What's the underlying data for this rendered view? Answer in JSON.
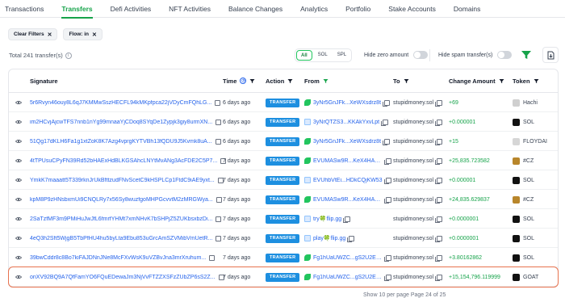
{
  "tabs": [
    "Transactions",
    "Transfers",
    "Defi Activities",
    "NFT Activities",
    "Balance Changes",
    "Analytics",
    "Portfolio",
    "Stake Accounts",
    "Domains"
  ],
  "active_tab": "Transfers",
  "chips": [
    {
      "label": "Clear Filters"
    },
    {
      "label": "Flow: in"
    }
  ],
  "total_text": "Total 241 transfer(s)",
  "segments": [
    "All",
    "SOL",
    "SPL"
  ],
  "active_segment": "All",
  "hide_zero_label": "Hide zero amount",
  "hide_spam_label": "Hide spam transfer(s)",
  "columns": {
    "signature": "Signature",
    "time": "Time",
    "action": "Action",
    "from": "From",
    "to": "To",
    "amount": "Change Amount",
    "token": "Token"
  },
  "colors": {
    "accent": "#16a34a",
    "badge": "#1d8fe0",
    "link": "#2563eb",
    "highlight": "#e8734f"
  },
  "rows": [
    {
      "signature": "5r6Rvyn46ouy8L6qJ7KMMwSszHECFL94kMKpfpca22jVDyCmFQhLG...",
      "time": "6 days ago",
      "action": "TRANSFER",
      "from": "3yNr5GnJFk...XeWXsdrz8t",
      "from_icon": "green-leaf-icon",
      "to": "stupidmoney.sol",
      "amount": "+69",
      "token": "Hachi",
      "token_color": "#cfcfcf"
    },
    {
      "signature": "im2HCvjAjcwTFS7nnb1nYg99mnaaYjCDoq8SYqDe1Zypjk3giy8urmXN...",
      "time": "6 days ago",
      "action": "TRANSFER",
      "from": "3yNrQTZS3...KKAkYxvLpt",
      "from_icon": "document-icon",
      "to": "stupidmoney.sol",
      "amount": "+0.000001",
      "token": "SOL",
      "token_color": "#111111"
    },
    {
      "signature": "51Qg17dKLH6Fa1g1xtZoK8K7Azg4vprgKYTVBh13fQDU9J5Kvmk8uA...",
      "time": "6 days ago",
      "action": "TRANSFER",
      "from": "3yNr5GnJFk...XeWXsdrz8t",
      "from_icon": "green-leaf-icon",
      "to": "stupidmoney.sol",
      "amount": "+15",
      "token": "FLOYDAI",
      "token_color": "#d6d6d6"
    },
    {
      "signature": "4tTPUsuCPyFN39Rd52bHAExHdBLKGSAhcLNYtMvANg3AcFDE2C5P7...",
      "time": "7 days ago",
      "action": "TRANSFER",
      "from": "EVUMASw9R...KeX4HAmK93",
      "from_icon": "green-leaf-icon",
      "to": "stupidmoney.sol",
      "amount": "+25,835.723582",
      "token": "#CZ",
      "token_color": "#b8862b"
    },
    {
      "signature": "YmkK7maaatt5T339rknJrUkBfttzudFNvScetC9kHSPLCp1FtdC9iAE9yxt...",
      "time": "7 days ago",
      "action": "TRANSFER",
      "from": "EVUhbVtEi...HDkCQjKW53",
      "from_icon": "document-icon",
      "to": "stupidmoney.sol",
      "amount": "+0.000001",
      "token": "SOL",
      "token_color": "#111111"
    },
    {
      "signature": "kpM8P9zHNsbxmUi9CNQLRy7x56Sy8wuzfgoMHPGcvvtM2zMRGWya...",
      "time": "7 days ago",
      "action": "TRANSFER",
      "from": "EVUMASw9R...KeX4HAmK93",
      "from_icon": "green-leaf-icon",
      "to": "stupidmoney.sol",
      "amount": "+24,835.629837",
      "token": "#CZ",
      "token_color": "#b8862b"
    },
    {
      "signature": "2SaTzfMF3m9PMiHuJwJfL6fmrfYHMt7xmNHvK7bSHPjZ5ZUKbsxbzDi...",
      "time": "7 days ago",
      "action": "TRANSFER",
      "from": "try🍀flip.gg",
      "from_icon": "document-icon",
      "to": "stupidmoney.sol",
      "amount": "+0.0000001",
      "token": "SOL",
      "token_color": "#111111"
    },
    {
      "signature": "4eQ3h2Sft5WjgB5TbPfHU4hu5byLta9Ebu853uGrcAmSZVMibVmUetR...",
      "time": "7 days ago",
      "action": "TRANSFER",
      "from": "play🍀flip.gg",
      "from_icon": "document-icon",
      "to": "stupidmoney.sol",
      "amount": "+0.0000001",
      "token": "SOL",
      "token_color": "#111111"
    },
    {
      "signature": "39bwCddr8c8Bo7kiFAJDNnJNe8McFXvWsK9uVZBvJna3mrXruhum...",
      "time": "7 days ago",
      "action": "TRANSFER",
      "from": "Fg1hUaUWZC...gS2U2EK14H",
      "from_icon": "green-leaf-icon",
      "to": "stupidmoney.sol",
      "amount": "+3.80162862",
      "token": "SOL",
      "token_color": "#111111"
    },
    {
      "signature": "onXV92BQ9A7QfFamYO6FQuEDewaJm3NjVvFTZZXSFzZUbZP6sS2Z...",
      "time": "7 days ago",
      "action": "TRANSFER",
      "from": "Fg1hUaUWZC...gS2U2EK14H",
      "from_icon": "green-leaf-icon",
      "to": "stupidmoney.sol",
      "amount": "+15,154,796.119999",
      "token": "GOAT",
      "token_color": "#111111",
      "highlight": true
    }
  ],
  "footer": {
    "show": "Show",
    "per_page": "10",
    "per_page_suffix": "per page",
    "page_text": "Page 24 of 25"
  }
}
